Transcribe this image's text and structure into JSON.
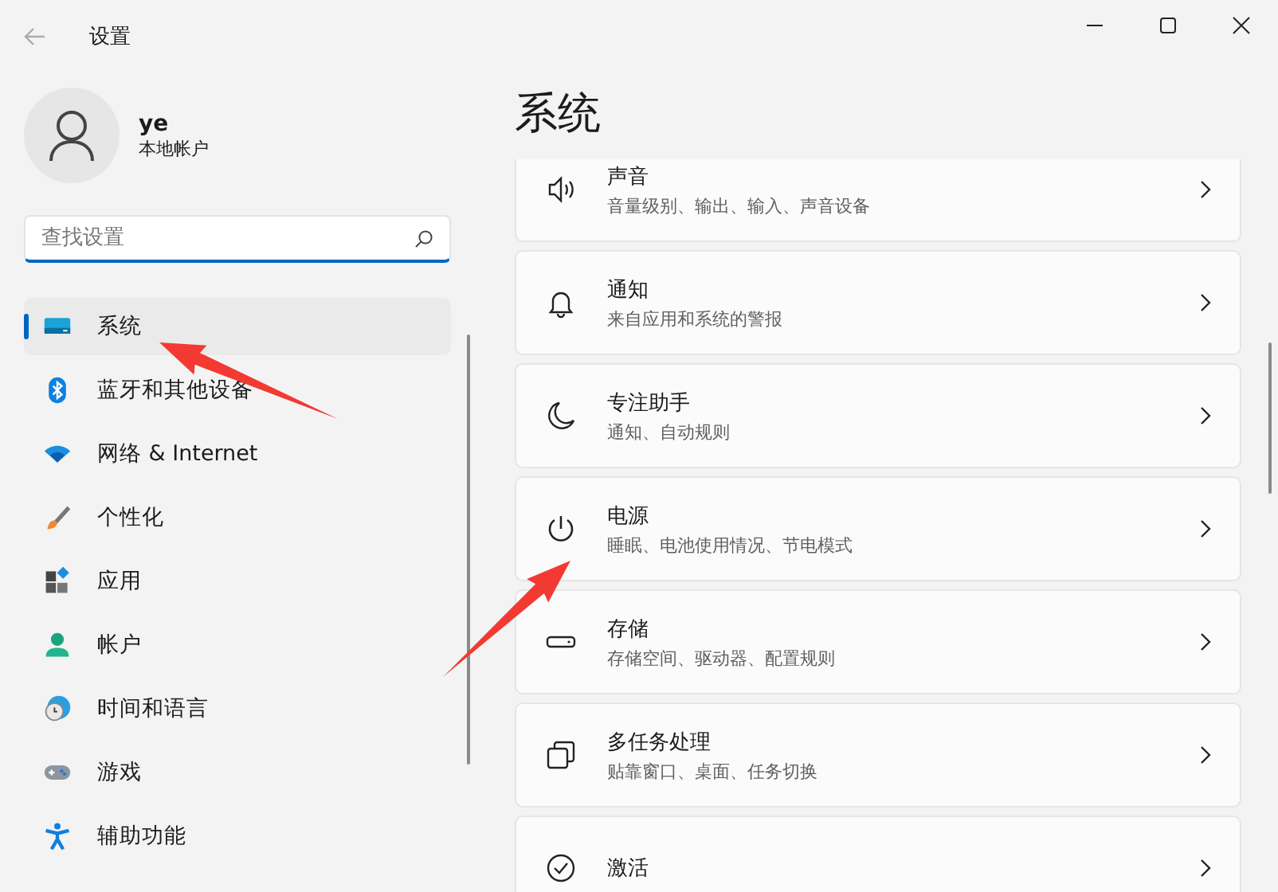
{
  "window": {
    "title": "设置",
    "back_disabled": true
  },
  "user": {
    "name": "ye",
    "account_type": "本地帐户"
  },
  "search": {
    "placeholder": "查找设置"
  },
  "nav_items": [
    {
      "label": "系统",
      "selected": true
    },
    {
      "label": "蓝牙和其他设备",
      "selected": false
    },
    {
      "label": "网络 & Internet",
      "selected": false
    },
    {
      "label": "个性化",
      "selected": false
    },
    {
      "label": "应用",
      "selected": false
    },
    {
      "label": "帐户",
      "selected": false
    },
    {
      "label": "时间和语言",
      "selected": false
    },
    {
      "label": "游戏",
      "selected": false
    },
    {
      "label": "辅助功能",
      "selected": false
    }
  ],
  "page_title": "系统",
  "settings": [
    {
      "title": "声音",
      "description": "音量级别、输出、输入、声音设备"
    },
    {
      "title": "通知",
      "description": "来自应用和系统的警报"
    },
    {
      "title": "专注助手",
      "description": "通知、自动规则"
    },
    {
      "title": "电源",
      "description": "睡眠、电池使用情况、节电模式"
    },
    {
      "title": "存储",
      "description": "存储空间、驱动器、配置规则"
    },
    {
      "title": "多任务处理",
      "description": "贴靠窗口、桌面、任务切换"
    },
    {
      "title": "激活"
    }
  ],
  "annotations": [
    {
      "kind": "arrow"
    },
    {
      "kind": "arrow"
    }
  ]
}
